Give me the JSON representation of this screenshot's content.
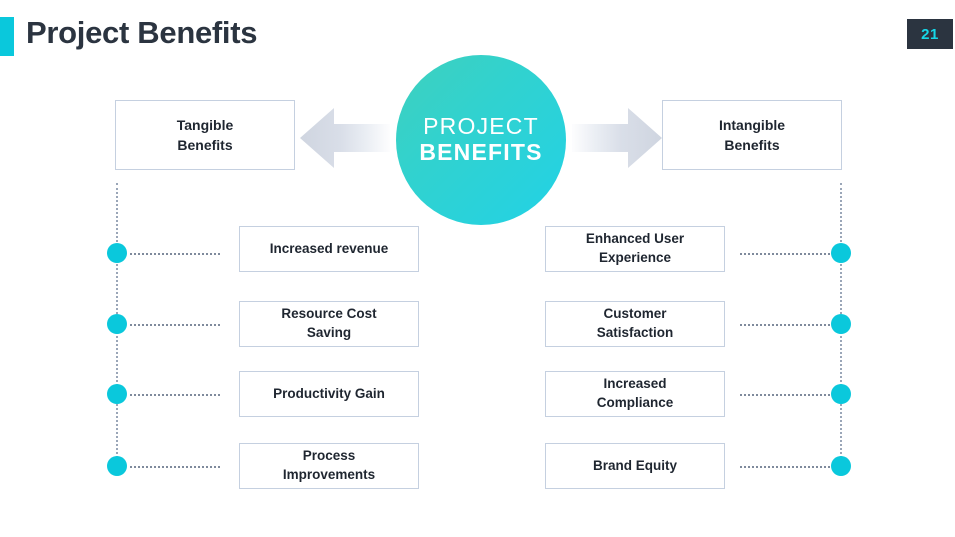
{
  "header": {
    "title": "Project Benefits",
    "page_number": "21",
    "accent_color": "#0ac8dc",
    "badge_bg_color": "#2b3440",
    "badge_text_color": "#16d7e8"
  },
  "center": {
    "line1": "PROJECT",
    "line2": "BENEFITS",
    "gradient_from": "#3fd0bd",
    "gradient_to": "#22d2e6"
  },
  "arrows": {
    "left": {
      "icon": "arrow-left-icon",
      "direction": "left"
    },
    "right": {
      "icon": "arrow-right-icon",
      "direction": "right"
    }
  },
  "branches": [
    {
      "side": "left",
      "heading": "Tangible\nBenefits",
      "heading_line1": "Tangible",
      "heading_line2": "Benefits",
      "node_color": "#0ac8dc",
      "items": [
        {
          "label": "Increased revenue",
          "line1": "Increased revenue",
          "line2": ""
        },
        {
          "label": "Resource Cost Saving",
          "line1": "Resource Cost",
          "line2": "Saving"
        },
        {
          "label": "Productivity Gain",
          "line1": "Productivity Gain",
          "line2": ""
        },
        {
          "label": "Process Improvements",
          "line1": "Process",
          "line2": "Improvements"
        }
      ]
    },
    {
      "side": "right",
      "heading": "Intangible\nBenefits",
      "heading_line1": "Intangible",
      "heading_line2": "Benefits",
      "node_color": "#0ac8dc",
      "items": [
        {
          "label": "Enhanced User Experience",
          "line1": "Enhanced User",
          "line2": "Experience"
        },
        {
          "label": "Customer Satisfaction",
          "line1": "Customer",
          "line2": "Satisfaction"
        },
        {
          "label": "Increased Compliance",
          "line1": "Increased",
          "line2": "Compliance"
        },
        {
          "label": "Brand Equity",
          "line1": "Brand Equity",
          "line2": ""
        }
      ]
    }
  ]
}
